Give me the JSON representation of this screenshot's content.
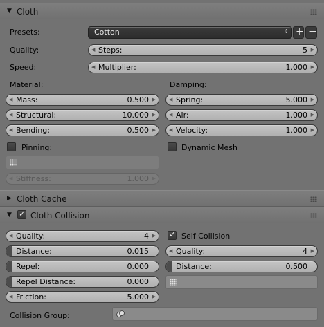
{
  "cloth": {
    "title": "Cloth",
    "presets_label": "Presets:",
    "presets_value": "Cotton",
    "quality_label": "Quality:",
    "steps_label": "Steps:",
    "steps_value": "5",
    "speed_label": "Speed:",
    "multiplier_label": "Multiplier:",
    "multiplier_value": "1.000",
    "material_label": "Material:",
    "damping_label": "Damping:",
    "mass_label": "Mass:",
    "mass_value": "0.500",
    "structural_label": "Structural:",
    "structural_value": "10.000",
    "bending_label": "Bending:",
    "bending_value": "0.500",
    "spring_label": "Spring:",
    "spring_value": "5.000",
    "air_label": "Air:",
    "air_value": "1.000",
    "velocity_label": "Velocity:",
    "velocity_value": "1.000",
    "pinning_label": "Pinning:",
    "dynamic_mesh_label": "Dynamic Mesh",
    "stiffness_label": "Stiffness:",
    "stiffness_value": "1.000"
  },
  "cache": {
    "title": "Cloth Cache"
  },
  "collision": {
    "title": "Cloth Collision",
    "enabled": true,
    "quality_label": "Quality:",
    "quality_value": "4",
    "distance_label": "Distance:",
    "distance_value": "0.015",
    "repel_label": "Repel:",
    "repel_value": "0.000",
    "repel_distance_label": "Repel Distance:",
    "repel_distance_value": "0.000",
    "friction_label": "Friction:",
    "friction_value": "5.000",
    "self_collision_label": "Self Collision",
    "self_collision_enabled": true,
    "self_quality_label": "Quality:",
    "self_quality_value": "4",
    "self_distance_label": "Distance:",
    "self_distance_value": "0.500",
    "collision_group_label": "Collision Group:"
  },
  "icons": {
    "add": "plus-icon",
    "remove": "minus-icon",
    "group": "vertex-group-icon",
    "object": "object-icon"
  }
}
